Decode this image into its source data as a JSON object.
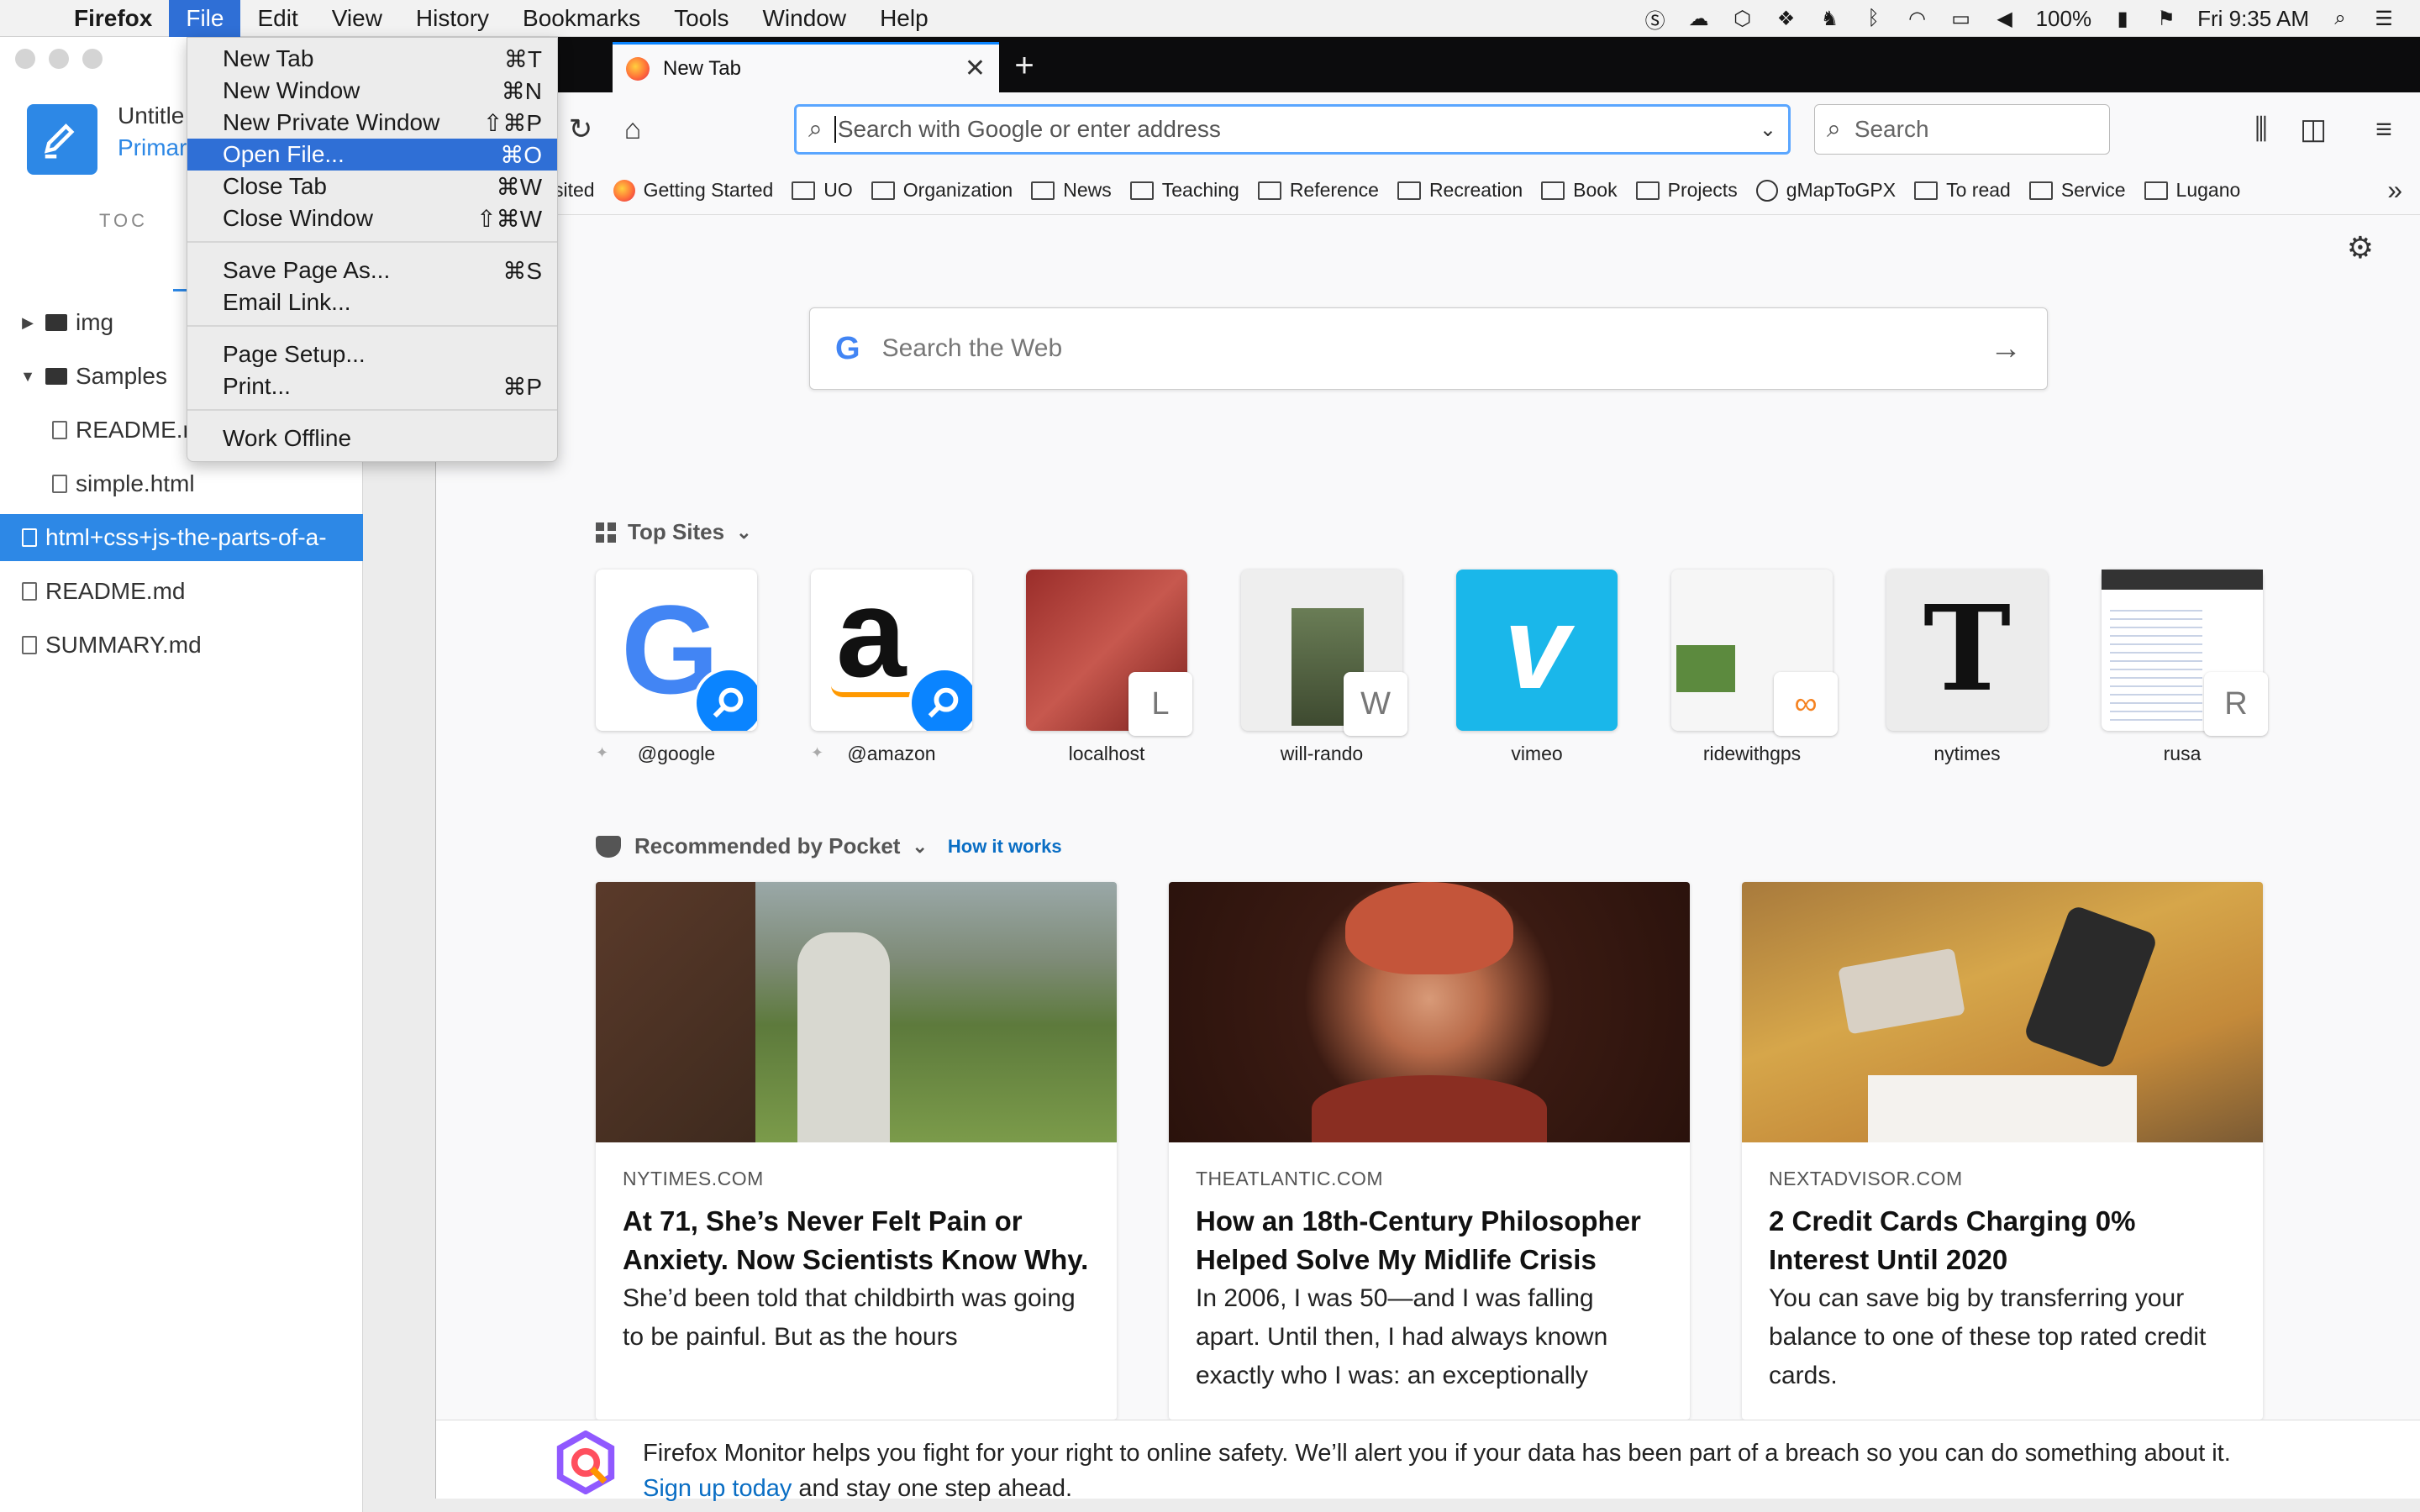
{
  "menubar": {
    "app_name": "Firefox",
    "items": [
      "File",
      "Edit",
      "View",
      "History",
      "Bookmarks",
      "Tools",
      "Window",
      "Help"
    ],
    "battery": "100%",
    "clock": "Fri 9:35 AM"
  },
  "file_menu": {
    "items": [
      {
        "label": "New Tab",
        "shortcut": "⌘T"
      },
      {
        "label": "New Window",
        "shortcut": "⌘N"
      },
      {
        "label": "New Private Window",
        "shortcut": "⇧⌘P"
      },
      {
        "label": "Open File...",
        "shortcut": "⌘O"
      },
      {
        "label": "Close Tab",
        "shortcut": "⌘W"
      },
      {
        "label": "Close Window",
        "shortcut": "⇧⌘W"
      },
      {
        "label": "Save Page As...",
        "shortcut": "⌘S"
      },
      {
        "label": "Email Link...",
        "shortcut": ""
      },
      {
        "label": "Page Setup...",
        "shortcut": ""
      },
      {
        "label": "Print...",
        "shortcut": "⌘P"
      },
      {
        "label": "Work Offline",
        "shortcut": ""
      }
    ]
  },
  "editor": {
    "doc_title": "Untitle",
    "doc_subtitle": "Primar",
    "toc_label": "TOC",
    "tree": [
      "img",
      "Samples",
      "README.r",
      "simple.html",
      "html+css+js-the-parts-of-a-",
      "README.md",
      "SUMMARY.md"
    ]
  },
  "browser": {
    "tab_title": "New Tab",
    "url_placeholder": "Search with Google or enter address",
    "search_placeholder": "Search",
    "bookmarks": [
      "sited",
      "Getting Started",
      "UO",
      "Organization",
      "News",
      "Teaching",
      "Reference",
      "Recreation",
      "Book",
      "Projects",
      "gMapToGPX",
      "To read",
      "Service",
      "Lugano"
    ],
    "websearch_placeholder": "Search the Web",
    "topsites_title": "Top Sites",
    "topsites": [
      {
        "label": "@google",
        "letter": ""
      },
      {
        "label": "@amazon",
        "letter": ""
      },
      {
        "label": "localhost",
        "letter": "L"
      },
      {
        "label": "will-rando",
        "letter": "W"
      },
      {
        "label": "vimeo",
        "letter": ""
      },
      {
        "label": "ridewithgps",
        "letter": ""
      },
      {
        "label": "nytimes",
        "letter": ""
      },
      {
        "label": "rusa",
        "letter": "R"
      }
    ],
    "pocket_title": "Recommended by Pocket",
    "pocket_how": "How it works",
    "cards": [
      {
        "source": "NYTIMES.COM",
        "title": "At 71, She’s Never Felt Pain or Anxiety. Now Scientists Know Why.",
        "excerpt": "She’d been told that childbirth was going to be painful. But as the hours"
      },
      {
        "source": "THEATLANTIC.COM",
        "title": "How an 18th-Century Philosopher Helped Solve My Midlife Crisis",
        "excerpt": "In 2006, I was 50—and I was falling apart. Until then, I had always known exactly who I was: an exceptionally"
      },
      {
        "source": "NEXTADVISOR.COM",
        "title": "2 Credit Cards Charging 0% Interest Until 2020",
        "excerpt": "You can save big by transferring your balance to one of these top rated credit cards."
      }
    ],
    "monitor_text": "Firefox Monitor helps you fight for your right to online safety. We’ll alert you if your data has been part of a breach so you can do something about it.",
    "monitor_link": "Sign up today",
    "monitor_tail": " and stay one step ahead."
  },
  "colors": {
    "accent": "#2f6fd6",
    "firefox_blue": "#0a84ff",
    "editor_blue": "#2d88e6"
  }
}
